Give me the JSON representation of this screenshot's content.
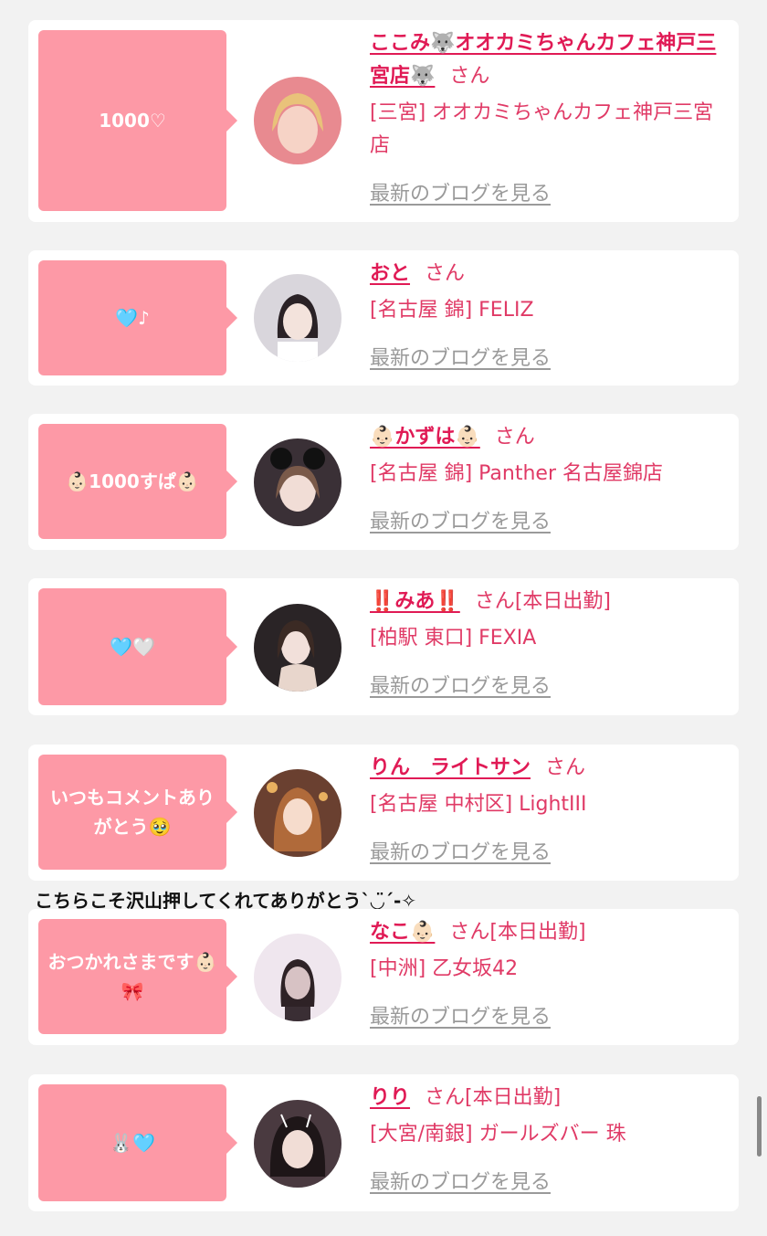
{
  "items": [
    {
      "comment": "1000♡",
      "name": "ここみ🐺オオカミちゃんカフェ神戸三宮店🐺",
      "honorific": "さん",
      "status": "",
      "shop": "[三宮] オオカミちゃんカフェ神戸三宮店",
      "blog_link": "最新のブログを見る"
    },
    {
      "comment": "🩵♪",
      "name": "おと",
      "honorific": "さん",
      "status": "",
      "shop": "[名古屋 錦] FELIZ",
      "blog_link": "最新のブログを見る"
    },
    {
      "comment": "👶🏻1000すぱ👶🏻",
      "name": "👶🏻かずは👶🏻",
      "honorific": "さん",
      "status": "",
      "shop": "[名古屋 錦] Panther 名古屋錦店",
      "blog_link": "最新のブログを見る"
    },
    {
      "comment": "🩵🤍",
      "name": "‼️みあ‼️",
      "honorific": "さん",
      "status": "[本日出勤]",
      "shop": "[柏駅 東口] FEXIA",
      "blog_link": "最新のブログを見る"
    },
    {
      "comment": "いつもコメントありがとう🥹",
      "name": "りん　ライトサン",
      "honorific": "さん",
      "status": "",
      "shop": "[名古屋 中村区] LightIII",
      "blog_link": "最新のブログを見る"
    },
    {
      "comment": "おつかれさまです👶🏻🎀",
      "name": "なこ👶🏻",
      "honorific": "さん",
      "status": "[本日出勤]",
      "shop": "[中洲] 乙女坂42",
      "blog_link": "最新のブログを見る"
    },
    {
      "comment": "🐰🩵",
      "name": "りり",
      "honorific": "さん",
      "status": "[本日出勤]",
      "shop": "[大宮/南銀] ガールズバー 珠",
      "blog_link": "最新のブログを見る"
    }
  ],
  "reply_comment": "こちらこそ沢山押してくれてありがとう`◡̈´-✧",
  "avatar_colors": [
    "#e88a90",
    "#d9d6dc",
    "#3a3036",
    "#2a2426",
    "#6a4030",
    "#efe6ee",
    "#4a3a40"
  ]
}
